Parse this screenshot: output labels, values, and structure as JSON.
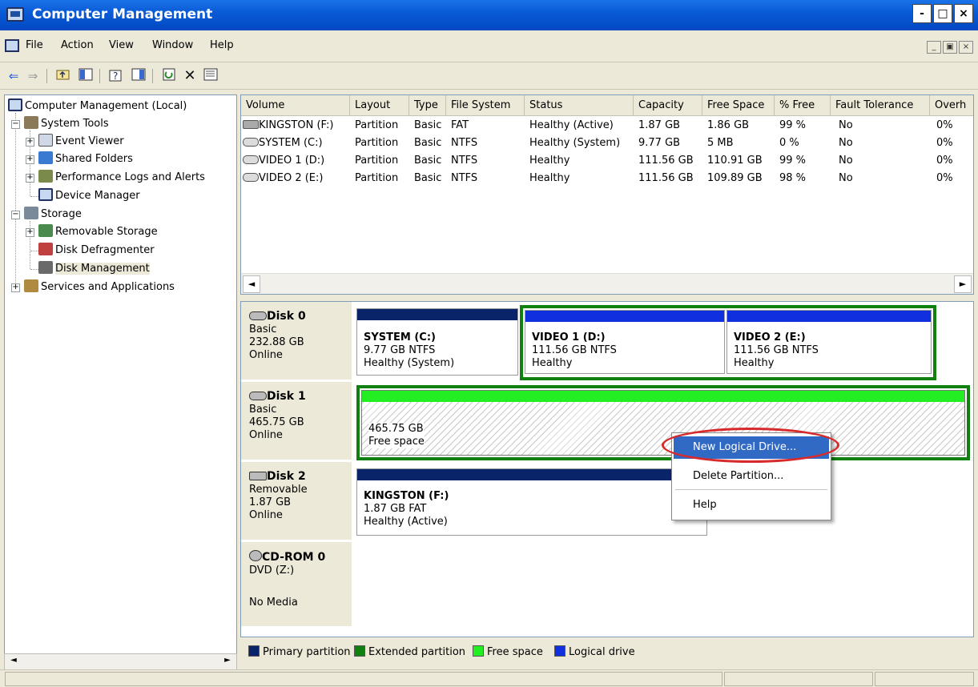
{
  "window": {
    "title": "Computer Management",
    "controls": {
      "minimize": "-",
      "maximize": "□",
      "close": "×"
    }
  },
  "menubar": {
    "items": [
      "File",
      "Action",
      "View",
      "Window",
      "Help"
    ],
    "mdi": {
      "minimize": "_",
      "restore": "▣",
      "close": "×"
    }
  },
  "toolbar": {
    "icons": [
      "back-arrow-icon",
      "forward-arrow-icon",
      "up-one-level-icon",
      "show-hide-tree-icon",
      "properties-icon",
      "help-icon",
      "refresh-icon",
      "delete-icon",
      "export-icon"
    ],
    "glyphs": {
      "back": "⇐",
      "forward": "⇒",
      "delete": "✕"
    }
  },
  "tree": {
    "root": "Computer Management (Local)",
    "system_tools": "System Tools",
    "event_viewer": "Event Viewer",
    "shared_folders": "Shared Folders",
    "perf_logs": "Performance Logs and Alerts",
    "device_manager": "Device Manager",
    "storage": "Storage",
    "removable_storage": "Removable Storage",
    "disk_defrag": "Disk Defragmenter",
    "disk_mgmt": "Disk Management",
    "services": "Services and Applications",
    "expand_glyph": "+",
    "collapse_glyph": "−"
  },
  "volumes": {
    "columns": [
      "Volume",
      "Layout",
      "Type",
      "File System",
      "Status",
      "Capacity",
      "Free Space",
      "% Free",
      "Fault Tolerance",
      "Overh"
    ],
    "rows": [
      [
        "KINGSTON (F:)",
        "Partition",
        "Basic",
        "FAT",
        "Healthy (Active)",
        "1.87 GB",
        "1.86 GB",
        "99 %",
        "No",
        "0%"
      ],
      [
        "SYSTEM (C:)",
        "Partition",
        "Basic",
        "NTFS",
        "Healthy (System)",
        "9.77 GB",
        "5 MB",
        "0 %",
        "No",
        "0%"
      ],
      [
        "VIDEO 1 (D:)",
        "Partition",
        "Basic",
        "NTFS",
        "Healthy",
        "111.56 GB",
        "110.91 GB",
        "99 %",
        "No",
        "0%"
      ],
      [
        "VIDEO 2 (E:)",
        "Partition",
        "Basic",
        "NTFS",
        "Healthy",
        "111.56 GB",
        "109.89 GB",
        "98 %",
        "No",
        "0%"
      ]
    ],
    "scroll": {
      "left": "◄",
      "right": "►"
    }
  },
  "disks": {
    "disk0": {
      "name": "Disk 0",
      "type": "Basic",
      "size": "232.88 GB",
      "status": "Online"
    },
    "disk1": {
      "name": "Disk 1",
      "type": "Basic",
      "size": "465.75 GB",
      "status": "Online"
    },
    "disk2": {
      "name": "Disk 2",
      "type": "Removable",
      "size": "1.87 GB",
      "status": "Online"
    },
    "cdrom0": {
      "name": "CD-ROM 0",
      "type": "DVD (Z:)",
      "status": "No Media"
    }
  },
  "partitions": {
    "system": {
      "name": "SYSTEM  (C:)",
      "size": "9.77 GB NTFS",
      "status": "Healthy (System)"
    },
    "video1": {
      "name": "VIDEO 1  (D:)",
      "size": "111.56 GB NTFS",
      "status": "Healthy"
    },
    "video2": {
      "name": "VIDEO 2  (E:)",
      "size": "111.56 GB NTFS",
      "status": "Healthy"
    },
    "free": {
      "size": "465.75 GB",
      "status": "Free space"
    },
    "kingston": {
      "name": "KINGSTON  (F:)",
      "size": "1.87 GB FAT",
      "status": "Healthy (Active)"
    }
  },
  "legend": {
    "items": [
      "Primary partition",
      "Extended partition",
      "Free space",
      "Logical drive"
    ],
    "colors": {
      "primary": "#0a246a",
      "extended": "#108010",
      "free": "#22ee22",
      "logical": "#1030e0"
    }
  },
  "context_menu": {
    "new_logical_drive": "New Logical Drive...",
    "delete_partition": "Delete Partition...",
    "help": "Help"
  },
  "colors": {
    "titlebar": "#0a5bd6",
    "highlight": "#316ac5",
    "annotation": "#d82a2a"
  }
}
